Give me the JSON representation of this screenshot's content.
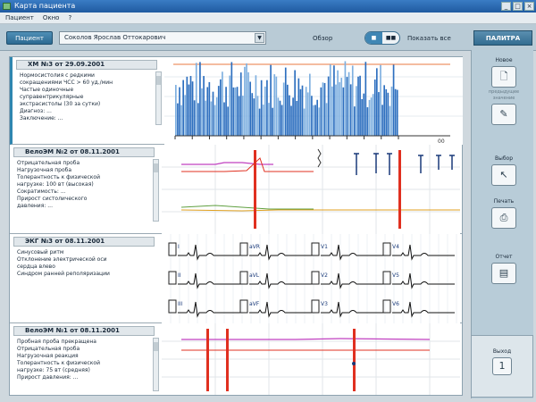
{
  "window": {
    "title": "Карта пациента",
    "buttons": [
      "_",
      "□",
      "×"
    ]
  },
  "menu": [
    "Пациент",
    "Окно",
    "?"
  ],
  "toolbar": {
    "patient_button": "Пациент",
    "patient_select": "Соколов Ярослав Оттокарович",
    "view_label": "Обзор",
    "toggle": [
      "■",
      "■■"
    ],
    "view_all": "Показать все",
    "palette": "ПАЛИТРА"
  },
  "records": [
    {
      "head": "ХМ №3 от 29.09.2001",
      "text": [
        "Нормосистолия с редкими",
        "сокращениями ЧСС > 60 уд./мин",
        "Частые одиночные",
        "суправентрикулярные",
        "экстрасистолы (30 за сутки)",
        "Диагноз: ...",
        "Заключение: ..."
      ],
      "chart_data": {
        "type": "bar",
        "title": "",
        "ylabel": "",
        "x_ticks": [
          "",
          "",
          "",
          "",
          "",
          "",
          "",
          "",
          "",
          "",
          "",
          "",
          "",
          ""
        ],
        "end_label": "00"
      }
    },
    {
      "head": "ВелоЭМ №2 от 08.11.2001",
      "text": [
        "Отрицательная проба",
        "Нагрузочная проба",
        "Толерантность к физической",
        "нагрузке: 100 вт (высокая)",
        "Сократимость: ...",
        "Прирост систолического",
        "давления: ..."
      ]
    },
    {
      "head": "ЭКГ №3 от 08.11.2001",
      "text": [
        "Синусовый ритм",
        "Отклонение электрической оси",
        "сердца влево",
        "Синдром ранней реполяризации"
      ],
      "leads": [
        "I",
        "aVR",
        "V1",
        "V4",
        "II",
        "aVL",
        "V2",
        "V5",
        "III",
        "aVF",
        "V3",
        "V6"
      ]
    },
    {
      "head": "ВелоЭМ №1 от 08.11.2001",
      "text": [
        "Пробная проба прекращена",
        "Отрицательная проба",
        "Нагрузочная реакция",
        "Толерантность к физической",
        "нагрузке: 75 вт (средняя)",
        "Прирост давления: ..."
      ]
    }
  ],
  "tools": [
    {
      "label": "Новое",
      "icon": "new-document-icon",
      "glyph": "🗋",
      "sub": "предыдущее значение"
    },
    {
      "label": "Выбор",
      "icon": "pointer-icon",
      "glyph": "↖"
    },
    {
      "label": "Печать",
      "icon": "printer-icon",
      "glyph": "⎙"
    },
    {
      "label": "Отчет",
      "icon": "report-icon",
      "glyph": "▤"
    },
    {
      "label": "Выход",
      "icon": "exit-icon",
      "glyph": "1"
    }
  ],
  "colors": {
    "accent": "#2f86b0",
    "bars": "#2d6fbf",
    "bars_light": "#7fb0e0",
    "marker_red": "#e03020",
    "trace_magenta": "#c040c0",
    "trace_green": "#60a040",
    "trace_orange": "#e0a020"
  }
}
